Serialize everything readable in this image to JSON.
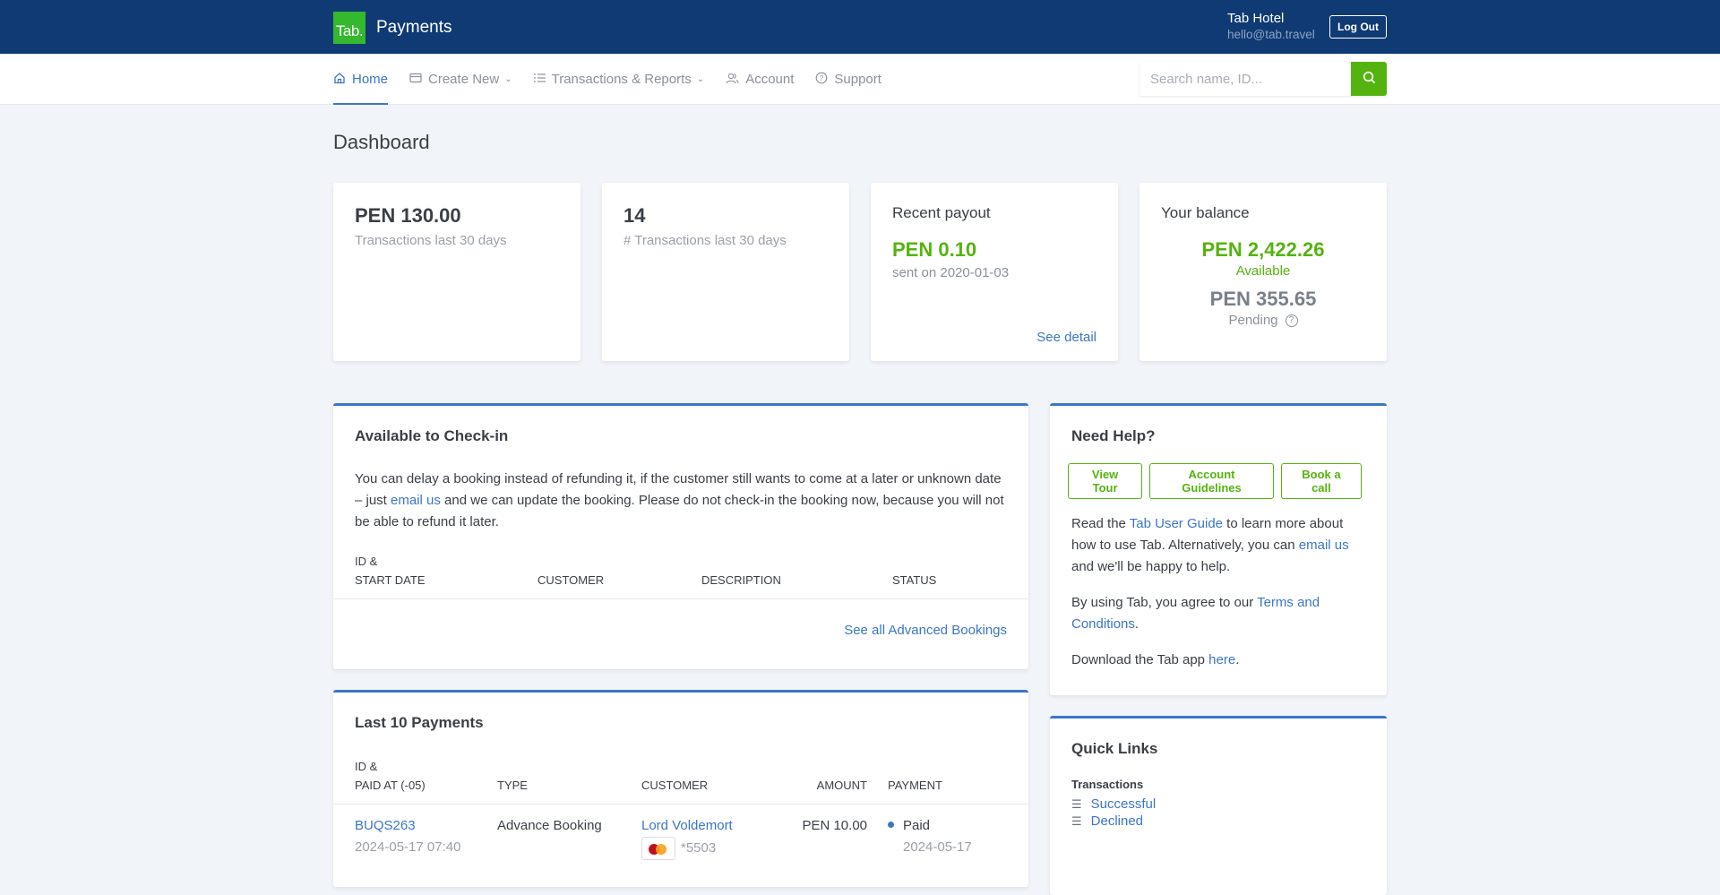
{
  "header": {
    "logo_text": "Tab.",
    "app_title": "Payments",
    "user_name": "Tab Hotel",
    "user_email": "hello@tab.travel",
    "logout_label": "Log Out"
  },
  "nav": {
    "items": [
      {
        "label": "Home",
        "icon": "home-icon",
        "active": true
      },
      {
        "label": "Create New",
        "icon": "card-icon",
        "dropdown": true
      },
      {
        "label": "Transactions & Reports",
        "icon": "list-icon",
        "dropdown": true
      },
      {
        "label": "Account",
        "icon": "users-icon"
      },
      {
        "label": "Support",
        "icon": "help-circle-icon"
      }
    ],
    "search_placeholder": "Search name, ID..."
  },
  "page": {
    "title": "Dashboard"
  },
  "stats": {
    "volume": {
      "value": "PEN 130.00",
      "label": "Transactions last 30 days"
    },
    "count": {
      "value": "14",
      "label": "# Transactions last 30 days"
    },
    "payout": {
      "title": "Recent payout",
      "value": "PEN 0.10",
      "sent": "sent on 2020-01-03",
      "link": "See detail"
    },
    "balance": {
      "title": "Your balance",
      "available": "PEN 2,422.26",
      "available_label": "Available",
      "pending": "PEN 355.65",
      "pending_label": "Pending"
    }
  },
  "checkin": {
    "title": "Available to Check-in",
    "text_1": "You can delay a booking instead of refunding it, if the customer still wants to come at a later or unknown date – just ",
    "link": "email us",
    "text_2": " and we can update the booking. Please do not check-in the booking now, because you will not be able to refund it later.",
    "columns": {
      "id_1": "ID &",
      "id_2": "START DATE",
      "customer": "CUSTOMER",
      "description": "DESCRIPTION",
      "status": "STATUS"
    },
    "see_all": "See all Advanced Bookings"
  },
  "payments": {
    "title": "Last 10 Payments",
    "columns": {
      "id_1": "ID &",
      "id_2": "PAID AT (-05)",
      "type": "TYPE",
      "customer": "CUSTOMER",
      "amount": "AMOUNT",
      "payment": "PAYMENT"
    },
    "rows": [
      {
        "id": "BUQS263",
        "paid_at": "2024-05-17 07:40",
        "type": "Advance Booking",
        "customer": "Lord Voldemort",
        "card": "*5503",
        "amount": "PEN 10.00",
        "status": "Paid",
        "status_date": "2024-05-17"
      }
    ]
  },
  "help": {
    "title": "Need Help?",
    "buttons": [
      "View Tour",
      "Account Guidelines",
      "Book a call"
    ],
    "p1_a": "Read the ",
    "p1_link1": "Tab User Guide",
    "p1_b": " to learn more about how to use Tab. Alternatively, you can ",
    "p1_link2": "email us",
    "p1_c": " and we'll be happy to help.",
    "p2_a": "By using Tab, you agree to our ",
    "p2_link": "Terms and Conditions",
    "p2_b": ".",
    "p3_a": "Download the Tab app ",
    "p3_link": "here",
    "p3_b": "."
  },
  "quick_links": {
    "title": "Quick Links",
    "section": "Transactions",
    "items": [
      "Successful",
      "Declined"
    ]
  }
}
